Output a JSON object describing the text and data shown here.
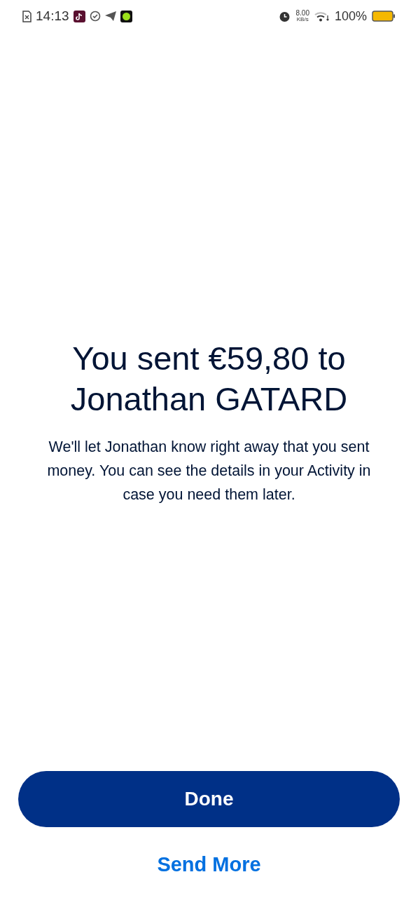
{
  "status_bar": {
    "time": "14:13",
    "net_speed": "8.00",
    "net_unit": "KB/s",
    "battery": "100%"
  },
  "title": "You sent €59,80 to Jonathan GATARD",
  "message": "We'll let Jonathan know right away that you sent money. You can see the details in your Activity in case you need them later.",
  "primary_button": "Done",
  "secondary_link": "Send More"
}
